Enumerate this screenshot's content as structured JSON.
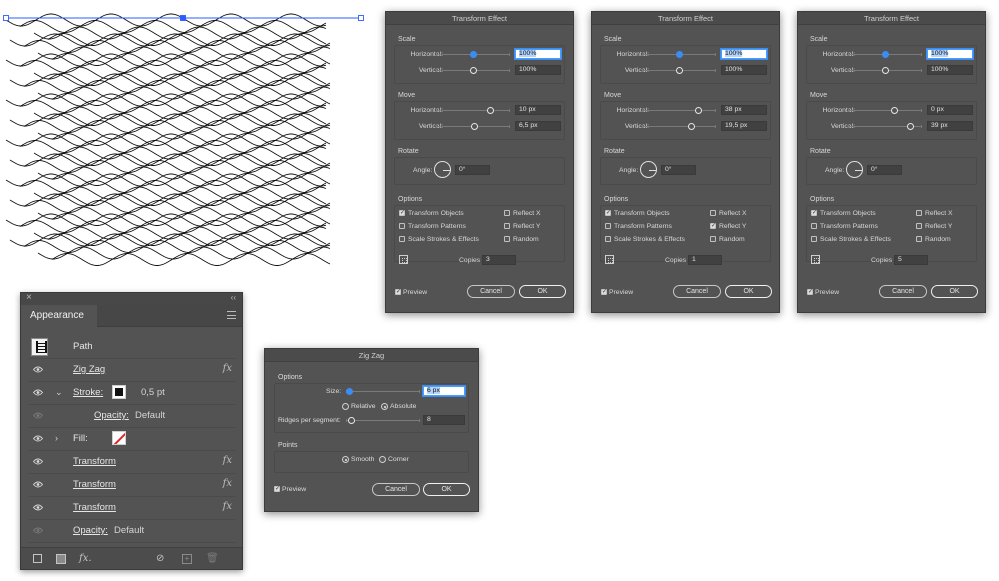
{
  "transform_dialogs": [
    {
      "title": "Transform Effect",
      "scale_label": "Scale",
      "horizontal_label": "Horizontal:",
      "vertical_label": "Vertical:",
      "scale_h": "100%",
      "scale_v": "100%",
      "move_label": "Move",
      "move_h": "10 px",
      "move_v": "6,5 px",
      "rotate_label": "Rotate",
      "angle_label": "Angle:",
      "angle": "0°",
      "options_label": "Options",
      "transform_objects": "Transform Objects",
      "transform_patterns": "Transform Patterns",
      "scale_strokes": "Scale Strokes & Effects",
      "reflect_x": "Reflect X",
      "reflect_y": "Reflect Y",
      "random": "Random",
      "transform_objects_checked": true,
      "transform_patterns_checked": false,
      "scale_strokes_checked": false,
      "reflect_x_checked": false,
      "reflect_y_checked": false,
      "random_checked": false,
      "copies_label": "Copies",
      "copies": "3",
      "preview_label": "Preview",
      "preview_checked": true,
      "cancel_label": "Cancel",
      "ok_label": "OK"
    },
    {
      "title": "Transform Effect",
      "scale_label": "Scale",
      "horizontal_label": "Horizontal:",
      "vertical_label": "Vertical:",
      "scale_h": "100%",
      "scale_v": "100%",
      "move_label": "Move",
      "move_h": "38 px",
      "move_v": "19,5 px",
      "rotate_label": "Rotate",
      "angle_label": "Angle:",
      "angle": "0°",
      "options_label": "Options",
      "transform_objects": "Transform Objects",
      "transform_patterns": "Transform Patterns",
      "scale_strokes": "Scale Strokes & Effects",
      "reflect_x": "Reflect X",
      "reflect_y": "Reflect Y",
      "random": "Random",
      "transform_objects_checked": true,
      "transform_patterns_checked": false,
      "scale_strokes_checked": false,
      "reflect_x_checked": false,
      "reflect_y_checked": true,
      "random_checked": false,
      "copies_label": "Copies",
      "copies": "1",
      "preview_label": "Preview",
      "preview_checked": true,
      "cancel_label": "Cancel",
      "ok_label": "OK"
    },
    {
      "title": "Transform Effect",
      "scale_label": "Scale",
      "horizontal_label": "Horizontal:",
      "vertical_label": "Vertical:",
      "scale_h": "100%",
      "scale_v": "100%",
      "move_label": "Move",
      "move_h": "0 px",
      "move_v": "39 px",
      "rotate_label": "Rotate",
      "angle_label": "Angle:",
      "angle": "0°",
      "options_label": "Options",
      "transform_objects": "Transform Objects",
      "transform_patterns": "Transform Patterns",
      "scale_strokes": "Scale Strokes & Effects",
      "reflect_x": "Reflect X",
      "reflect_y": "Reflect Y",
      "random": "Random",
      "transform_objects_checked": true,
      "transform_patterns_checked": false,
      "scale_strokes_checked": false,
      "reflect_x_checked": false,
      "reflect_y_checked": false,
      "random_checked": false,
      "copies_label": "Copies",
      "copies": "5",
      "preview_label": "Preview",
      "preview_checked": true,
      "cancel_label": "Cancel",
      "ok_label": "OK"
    }
  ],
  "appearance": {
    "title": "Appearance",
    "path_label": "Path",
    "rows": [
      {
        "name": "Zig Zag",
        "fx": "fx"
      },
      {
        "name": "Stroke:",
        "value": "0,5 pt"
      },
      {
        "name": "Opacity:",
        "value": "Default"
      },
      {
        "name": "Fill:"
      },
      {
        "name": "Transform",
        "fx": "fx"
      },
      {
        "name": "Transform",
        "fx": "fx"
      },
      {
        "name": "Transform",
        "fx": "fx"
      },
      {
        "name": "Opacity:",
        "value": "Default"
      }
    ],
    "footer_fx": "fx."
  },
  "zigzag": {
    "title": "Zig Zag",
    "options_label": "Options",
    "size_label": "Size:",
    "size": "6 px",
    "relative_label": "Relative",
    "absolute_label": "Absolute",
    "relative_selected": false,
    "absolute_selected": true,
    "ridges_label": "Ridges per segment:",
    "ridges": "8",
    "points_label": "Points",
    "smooth_label": "Smooth",
    "corner_label": "Corner",
    "smooth_selected": true,
    "corner_selected": false,
    "preview_label": "Preview",
    "preview_checked": true,
    "cancel_label": "Cancel",
    "ok_label": "OK"
  },
  "colors": {
    "selection": "#2b5cff",
    "panel": "#535353",
    "accent": "#3b8df5"
  }
}
